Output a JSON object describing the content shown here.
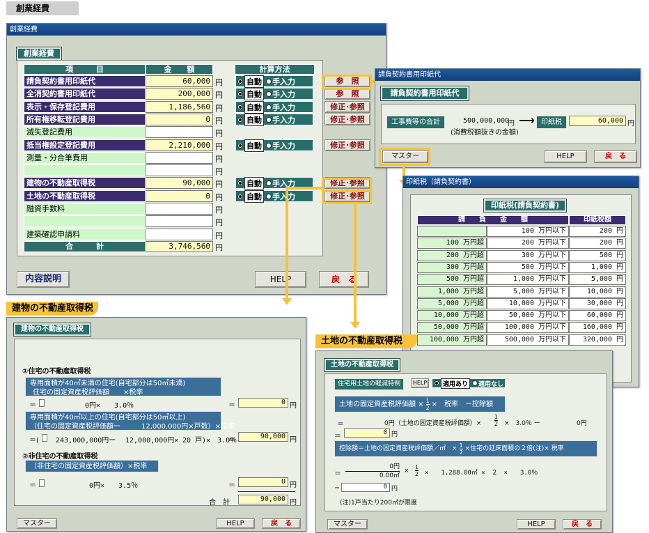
{
  "page_label": "創業経費",
  "main": {
    "title": "創業経費",
    "heading": "創業経費",
    "col_item": "項　　　目",
    "col_amount": "金　　額",
    "col_method": "計算方法",
    "rows": [
      {
        "label": "請負契約書用印紙代",
        "value": "60,000",
        "unit": "円",
        "auto": "自動",
        "manual": "手入力",
        "btn": "参　照"
      },
      {
        "label": "全消契約書用印紙代",
        "value": "200,000",
        "unit": "円",
        "auto": "自動",
        "manual": "手入力",
        "btn": "参　照"
      },
      {
        "label": "表示・保存登記費用",
        "value": "1,186,560",
        "unit": "円",
        "auto": "自動",
        "manual": "手入力",
        "btn": "修正･参照"
      },
      {
        "label": "所有権移転登記費用",
        "value": "0",
        "unit": "円",
        "auto": "自動",
        "manual": "手入力",
        "btn": "修正･参照"
      },
      {
        "label": "滅失登記費用",
        "value": "",
        "unit": "円"
      },
      {
        "label": "抵当権設定登記費用",
        "value": "2,210,000",
        "unit": "円",
        "auto": "自動",
        "manual": "手入力",
        "btn": "修正･参照"
      },
      {
        "label": "測量・分合筆費用",
        "value": "",
        "unit": "円"
      },
      {
        "label": "",
        "value": "",
        "unit": "円"
      },
      {
        "label": "建物の不動産取得税",
        "value": "90,000",
        "unit": "円",
        "auto": "自動",
        "manual": "手入力",
        "btn": "修正･参照"
      },
      {
        "label": "土地の不動産取得税",
        "value": "0",
        "unit": "円",
        "auto": "自動",
        "manual": "手入力",
        "btn": "修正･参照"
      },
      {
        "label": "融資手数料",
        "value": "",
        "unit": "円"
      },
      {
        "label": "",
        "value": "",
        "unit": "円"
      },
      {
        "label": "建築確認申請料",
        "value": "",
        "unit": "円"
      }
    ],
    "total_label": "合　　　計",
    "total_value": "3,746,560",
    "total_unit": "円",
    "explain_btn": "内容説明",
    "help_btn": "HELP",
    "back_btn": "戻　る"
  },
  "stamp_win": {
    "title": "請負契約書用印紙代",
    "heading": "請負契約書用印紙代",
    "label": "工事費等の合計",
    "amount": "500,000,000",
    "unit": "円",
    "note": "(消費税額抜きの金額)",
    "arrow": "⟶",
    "tax_label": "印紙税",
    "tax_value": "60,000",
    "tax_unit": "円",
    "master_btn": "マスター",
    "help_btn": "HELP",
    "back_btn": "戻　る"
  },
  "master_win": {
    "title": "印紙税（請負契約書）",
    "heading": "印紙税(請負契約書)",
    "col_amount": "請　　負　　金　　額",
    "col_tax": "印紙税額",
    "rows": [
      [
        "",
        "100 万円以下",
        "200 円"
      ],
      [
        "100 万円超",
        "200 万円以下",
        "200 円"
      ],
      [
        "200 万円超",
        "300 万円以下",
        "500 円"
      ],
      [
        "300 万円超",
        "500 万円以下",
        "1,000 円"
      ],
      [
        "500 万円超",
        "1,000 万円以下",
        "5,000 円"
      ],
      [
        "1,000 万円超",
        "5,000 万円以下",
        "10,000 円"
      ],
      [
        "5,000 万円超",
        "10,000 万円以下",
        "30,000 円"
      ],
      [
        "10,000 万円超",
        "50,000 万円以下",
        "60,000 円"
      ],
      [
        "50,000 万円超",
        "100,000 万円以下",
        "160,000 円"
      ],
      [
        "100,000 万円超",
        "500,000 万円以下",
        "320,000 円"
      ]
    ]
  },
  "building": {
    "callout": "建物の不動産取得税",
    "heading": "建物の不動産取得税",
    "sec1": "①住宅の不動産取得税",
    "box1_l1": "専用面積が40㎡未満の住宅(自宅部分は50㎡未満)",
    "box1_l2": "住宅の固定資産税評価額　　×税率",
    "eq1_left": "＝",
    "eq1_mid": "0円×　　3.0％",
    "eq1_eq": "＝",
    "eq1_val": "0",
    "eq1_unit": "円",
    "box2_l1": "専用面積が40㎡以上の住宅(自宅部分は50㎡以上)",
    "box2_l2": "（住宅の固定資産税評価額ー　　　12,000,000円×戸数）×税率",
    "eq2_left": "＝(",
    "eq2_mid": "243,000,000円ー",
    "eq2_mid2": "12,000,000円×",
    "eq2_mid3": "20 戸)×　3.0％",
    "eq2_eq": "＝",
    "eq2_val": "90,000",
    "eq2_unit": "円",
    "sec2": "②非住宅の不動産取得税",
    "box3": "（非住宅の固定資産税評価額）×税率",
    "eq3_left": "＝",
    "eq3_mid": "0円×　　3.5％",
    "eq3_eq": "＝",
    "eq3_val": "0",
    "eq3_unit": "円",
    "total_label": "合　計",
    "total_val": "90,000",
    "total_unit": "円",
    "master_btn": "マスター",
    "help_btn": "HELP",
    "back_btn": "戻　る"
  },
  "land": {
    "callout": "土地の不動産取得税",
    "heading": "土地の不動産取得税",
    "special": "住宅用土地の軽減特例",
    "help_small": "HELP",
    "opt_yes": "適用あり",
    "opt_no": "適用なし",
    "box1": "土地の固定資産税評価額 ×",
    "box1_frac_n": "1",
    "box1_frac_d": "2",
    "box1_tail": "×　税率　ー控除額",
    "eq1_left": "＝",
    "eq1_a": "0円（土地の固定資産税評価額）×",
    "eq1_frac_n": "1",
    "eq1_frac_d": "2",
    "eq1_b": "×　3.0％ ー",
    "eq1_c": "0円",
    "eq1_line2": "＝",
    "eq1_val": "0",
    "eq1_unit": "円",
    "box2": "控除額＝土地の固定資産税評価額／㎡　×",
    "box2_frac_n": "1",
    "box2_frac_d": "2",
    "box2_tail": "×住宅の延床面積の２倍(注)× 税率",
    "eq2_num": "0円",
    "eq2_den": "0.00㎡",
    "eq2_left": "＝",
    "eq2_x": "×",
    "eq2_frac_n": "1",
    "eq2_frac_d": "2",
    "eq2_tail": "×　　1,288.00㎡ ×　２　×　　3.0％",
    "eq3_left": "＝",
    "eq3_val": "0",
    "eq3_unit": "円",
    "note": "(注)1戸当たり200㎡が限度",
    "master_btn": "マスター",
    "help_btn": "HELP",
    "back_btn": "戻　る"
  }
}
